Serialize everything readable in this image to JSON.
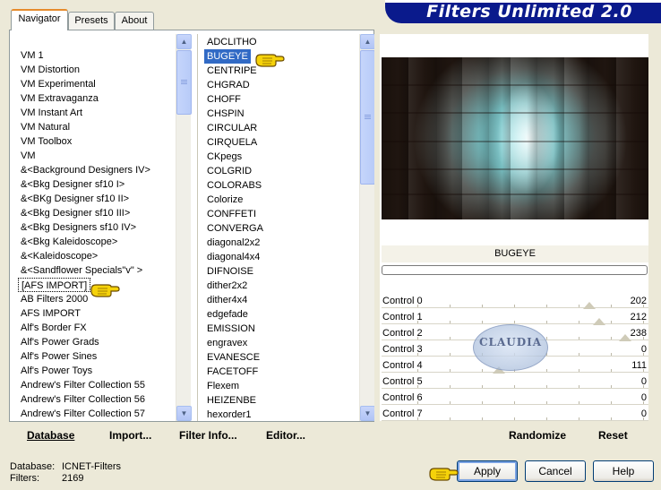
{
  "tabs": [
    {
      "label": "Navigator",
      "active": true
    },
    {
      "label": "Presets",
      "active": false
    },
    {
      "label": "About",
      "active": false
    }
  ],
  "title": "Filters Unlimited 2.0",
  "categories": [
    "VM 1",
    "VM Distortion",
    "VM Experimental",
    "VM Extravaganza",
    "VM Instant Art",
    "VM Natural",
    "VM Toolbox",
    "VM",
    "&<Background Designers IV>",
    "&<Bkg Designer sf10 I>",
    "&<BKg Designer sf10 II>",
    "&<Bkg Designer sf10 III>",
    "&<Bkg Designers sf10 IV>",
    "&<Bkg Kaleidoscope>",
    "&<Kaleidoscope>",
    "&<Sandflower Specials\"v\" >",
    "[AFS IMPORT]",
    "AB Filters 2000",
    "AFS IMPORT",
    "Alf's Border FX",
    "Alf's Power Grads",
    "Alf's Power Sines",
    "Alf's Power Toys",
    "Andrew's Filter Collection 55",
    "Andrew's Filter Collection 56",
    "Andrew's Filter Collection 57"
  ],
  "selected_category": "[AFS IMPORT]",
  "filters": [
    "ADCLITHO",
    "BUGEYE",
    "CENTRIPE",
    "CHGRAD",
    "CHOFF",
    "CHSPIN",
    "CIRCULAR",
    "CIRQUELA",
    "CKpegs",
    "COLGRID",
    "COLORABS",
    "Colorize",
    "CONFFETI",
    "CONVERGA",
    "diagonal2x2",
    "diagonal4x4",
    "DIFNOISE",
    "dither2x2",
    "dither4x4",
    "edgefade",
    "EMISSION",
    "engravex",
    "EVANESCE",
    "FACETOFF",
    "Flexem",
    "HEIZENBE",
    "hexorder1"
  ],
  "selected_filter": "BUGEYE",
  "filter_name": "BUGEYE",
  "controls": [
    {
      "label": "Control 0",
      "value": "202"
    },
    {
      "label": "Control 1",
      "value": "212"
    },
    {
      "label": "Control 2",
      "value": "238"
    },
    {
      "label": "Control 3",
      "value": "0"
    },
    {
      "label": "Control 4",
      "value": "111"
    },
    {
      "label": "Control 5",
      "value": "0"
    },
    {
      "label": "Control 6",
      "value": "0"
    },
    {
      "label": "Control 7",
      "value": "0"
    }
  ],
  "toolbar": {
    "database": "Database",
    "import": "Import...",
    "filter_info": "Filter Info...",
    "editor": "Editor...",
    "randomize": "Randomize",
    "reset": "Reset"
  },
  "info": {
    "database_label": "Database:",
    "database_value": "ICNET-Filters",
    "filters_label": "Filters:",
    "filters_value": "2169"
  },
  "buttons": {
    "apply": "Apply",
    "cancel": "Cancel",
    "help": "Help"
  },
  "watermark": "CLAUDIA",
  "colors": {
    "selection": "#316ac5",
    "banner": "#0a1a8c",
    "accent_tab": "#e68b2c"
  }
}
